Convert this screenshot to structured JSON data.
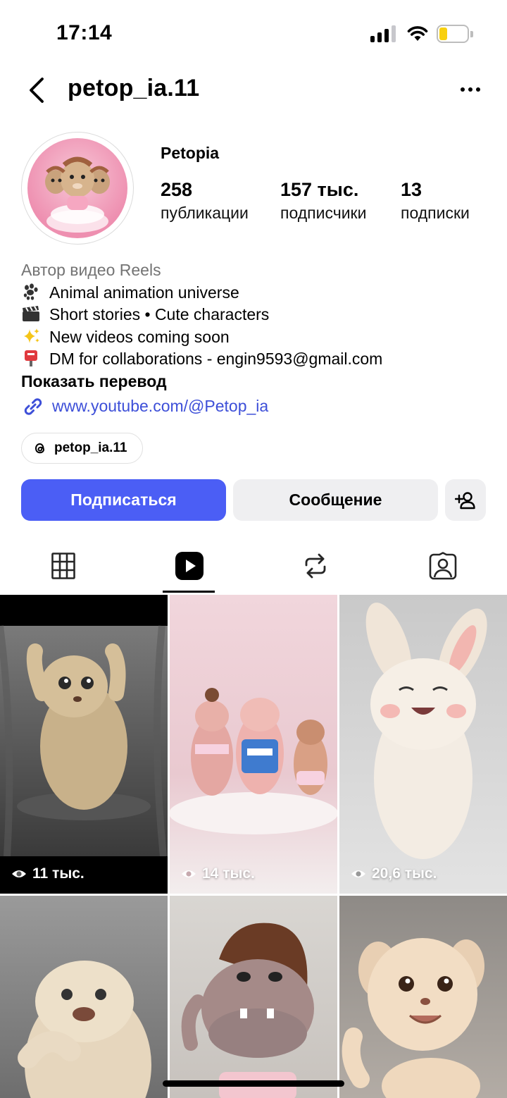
{
  "status_bar": {
    "time": "17:14",
    "battery_level": 0.2
  },
  "nav": {
    "username": "petop_ia.11",
    "back_icon": "chevron-left-icon",
    "more_icon": "more-horizontal-icon"
  },
  "profile": {
    "display_name": "Petopia",
    "stats": [
      {
        "value": "258",
        "label": "публикации"
      },
      {
        "value": "157 тыс.",
        "label": "подписчики"
      },
      {
        "value": "13",
        "label": "подписки"
      }
    ]
  },
  "bio": {
    "category": "Автор видео Reels",
    "lines": [
      {
        "emoji": "paw-prints-icon",
        "text": "Animal animation universe"
      },
      {
        "emoji": "clapper-board-icon",
        "text": "Short stories • Cute characters"
      },
      {
        "emoji": "sparkles-icon",
        "text": "New videos coming soon"
      },
      {
        "emoji": "postbox-icon",
        "text": "DM for collaborations - engin9593@gmail.com"
      }
    ],
    "translate_label": "Показать перевод",
    "link": "www.youtube.com/@Petop_ia"
  },
  "threads": {
    "handle": "petop_ia.11"
  },
  "actions": {
    "follow": "Подписаться",
    "message": "Сообщение",
    "add_icon": "person-add-icon"
  },
  "tabs": [
    {
      "name": "grid",
      "icon": "grid-icon",
      "active": false
    },
    {
      "name": "reels",
      "icon": "reels-play-icon",
      "active": true
    },
    {
      "name": "reposts",
      "icon": "repost-icon",
      "active": false
    },
    {
      "name": "tagged",
      "icon": "tagged-person-icon",
      "active": false
    }
  ],
  "reels": [
    {
      "views": "11 тыс.",
      "subject": "fluffy beige creature with raised arms"
    },
    {
      "views": "14 тыс.",
      "subject": "three cartoon pigs dancing"
    },
    {
      "views": "20,6 тыс.",
      "subject": "laughing white bunny"
    },
    {
      "views": "",
      "subject": "fluffy beige creature"
    },
    {
      "views": "",
      "subject": "hippo character"
    },
    {
      "views": "",
      "subject": "smiling fluffy puppy"
    }
  ],
  "colors": {
    "accent": "#4b5ef5",
    "link": "#3d4fd8",
    "secondary_text": "#737373",
    "button_bg": "#efeff1"
  }
}
